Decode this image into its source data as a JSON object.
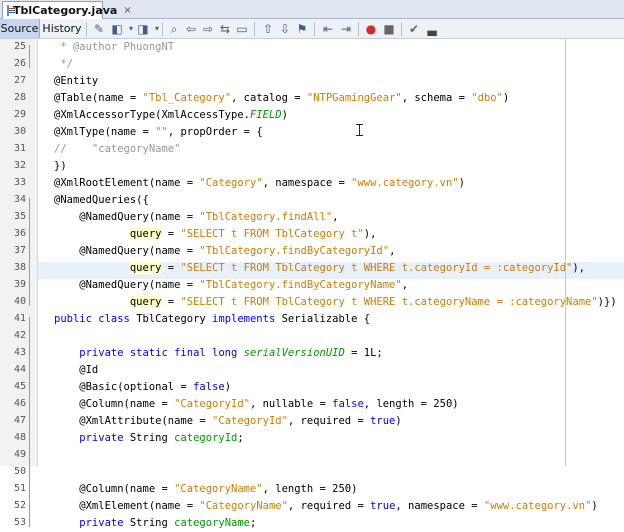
{
  "file_tab": {
    "title": "TblCategory.java",
    "close": "×"
  },
  "toolbar": {
    "source_label": "Source",
    "history_label": "History"
  },
  "lines": [
    {
      "n": "25",
      "segs": [
        {
          "t": " * ",
          "c": "cmt"
        },
        {
          "t": "@author PhuongNT",
          "c": "cmt"
        }
      ]
    },
    {
      "n": "26",
      "segs": [
        {
          "t": " */",
          "c": "cmt"
        }
      ]
    },
    {
      "n": "27",
      "segs": [
        {
          "t": "@Entity",
          "c": "ann"
        }
      ]
    },
    {
      "n": "28",
      "segs": [
        {
          "t": "@Table(name = ",
          "c": "ann"
        },
        {
          "t": "\"Tbl_Category\"",
          "c": "str"
        },
        {
          "t": ", catalog = ",
          "c": ""
        },
        {
          "t": "\"NTPGamingGear\"",
          "c": "str"
        },
        {
          "t": ", schema = ",
          "c": ""
        },
        {
          "t": "\"dbo\"",
          "c": "str"
        },
        {
          "t": ")",
          "c": ""
        }
      ]
    },
    {
      "n": "29",
      "segs": [
        {
          "t": "@XmlAccessorType(XmlAccessType.",
          "c": "ann"
        },
        {
          "t": "FIELD",
          "c": "ital"
        },
        {
          "t": ")",
          "c": ""
        }
      ]
    },
    {
      "n": "30",
      "segs": [
        {
          "t": "@XmlType(name = ",
          "c": "ann"
        },
        {
          "t": "\"\"",
          "c": "str"
        },
        {
          "t": ", propOrder = {",
          "c": ""
        }
      ]
    },
    {
      "n": "31",
      "segs": [
        {
          "t": "//    \"categoryName\"",
          "c": "cmt"
        }
      ]
    },
    {
      "n": "32",
      "segs": [
        {
          "t": "})",
          "c": ""
        }
      ]
    },
    {
      "n": "33",
      "segs": [
        {
          "t": "@XmlRootElement(name = ",
          "c": "ann"
        },
        {
          "t": "\"Category\"",
          "c": "str"
        },
        {
          "t": ", namespace = ",
          "c": ""
        },
        {
          "t": "\"www.category.vn\"",
          "c": "str"
        },
        {
          "t": ")",
          "c": ""
        }
      ]
    },
    {
      "n": "34",
      "segs": [
        {
          "t": "@NamedQueries({",
          "c": "ann"
        }
      ]
    },
    {
      "n": "35",
      "segs": [
        {
          "t": "    @NamedQuery(name = ",
          "c": "ann"
        },
        {
          "t": "\"TblCategory.findAll\"",
          "c": "str"
        },
        {
          "t": ",",
          "c": ""
        }
      ]
    },
    {
      "n": "36",
      "segs": [
        {
          "t": "            ",
          "c": ""
        },
        {
          "t": "query",
          "c": "q"
        },
        {
          "t": " = ",
          "c": ""
        },
        {
          "t": "\"SELECT t FROM TblCategory t\"",
          "c": "str"
        },
        {
          "t": "),",
          "c": ""
        }
      ]
    },
    {
      "n": "37",
      "segs": [
        {
          "t": "    @NamedQuery(name = ",
          "c": "ann"
        },
        {
          "t": "\"TblCategory.findByCategoryId\"",
          "c": "str"
        },
        {
          "t": ",",
          "c": ""
        }
      ]
    },
    {
      "n": "38",
      "segs": [
        {
          "t": "            ",
          "c": ""
        },
        {
          "t": "query",
          "c": "q"
        },
        {
          "t": " = ",
          "c": ""
        },
        {
          "t": "\"SELECT t FROM TblCategory t WHERE t.categoryId = :categoryId\"",
          "c": "str"
        },
        {
          "t": "),",
          "c": ""
        }
      ]
    },
    {
      "n": "39",
      "segs": [
        {
          "t": "    @NamedQuery(name = ",
          "c": "ann"
        },
        {
          "t": "\"TblCategory.findByCategoryName\"",
          "c": "str"
        },
        {
          "t": ",",
          "c": ""
        }
      ]
    },
    {
      "n": "40",
      "segs": [
        {
          "t": "            ",
          "c": ""
        },
        {
          "t": "query",
          "c": "q"
        },
        {
          "t": " = ",
          "c": ""
        },
        {
          "t": "\"SELECT t FROM TblCategory t WHERE t.categoryName = :categoryName\"",
          "c": "str"
        },
        {
          "t": ")})",
          "c": ""
        }
      ]
    },
    {
      "n": "41",
      "segs": [
        {
          "t": "public class ",
          "c": "kw"
        },
        {
          "t": "TblCategory ",
          "c": ""
        },
        {
          "t": "implements ",
          "c": "kw"
        },
        {
          "t": "Serializable {",
          "c": ""
        }
      ]
    },
    {
      "n": "42",
      "segs": []
    },
    {
      "n": "43",
      "segs": [
        {
          "t": "    private static final long ",
          "c": "kw"
        },
        {
          "t": "serialVersionUID",
          "c": "ital"
        },
        {
          "t": " = 1L;",
          "c": ""
        }
      ]
    },
    {
      "n": "44",
      "segs": [
        {
          "t": "    @Id",
          "c": "ann"
        }
      ]
    },
    {
      "n": "45",
      "segs": [
        {
          "t": "    @Basic(optional = ",
          "c": "ann"
        },
        {
          "t": "false",
          "c": "kw"
        },
        {
          "t": ")",
          "c": ""
        }
      ]
    },
    {
      "n": "46",
      "segs": [
        {
          "t": "    @Column(name = ",
          "c": "ann"
        },
        {
          "t": "\"CategoryId\"",
          "c": "str"
        },
        {
          "t": ", nullable = ",
          "c": ""
        },
        {
          "t": "false",
          "c": "kw"
        },
        {
          "t": ", length = 250)",
          "c": ""
        }
      ]
    },
    {
      "n": "47",
      "segs": [
        {
          "t": "    @XmlAttribute(name = ",
          "c": "ann"
        },
        {
          "t": "\"CategoryId\"",
          "c": "str"
        },
        {
          "t": ", required = ",
          "c": ""
        },
        {
          "t": "true",
          "c": "kw"
        },
        {
          "t": ")",
          "c": ""
        }
      ]
    },
    {
      "n": "48",
      "segs": [
        {
          "t": "    private ",
          "c": "kw"
        },
        {
          "t": "String ",
          "c": ""
        },
        {
          "t": "categoryId",
          "c": "fld"
        },
        {
          "t": ";",
          "c": ""
        }
      ]
    },
    {
      "n": "49",
      "segs": []
    },
    {
      "n": "50",
      "segs": []
    },
    {
      "n": "51",
      "segs": [
        {
          "t": "    @Column(name = ",
          "c": "ann"
        },
        {
          "t": "\"CategoryName\"",
          "c": "str"
        },
        {
          "t": ", length = 250)",
          "c": ""
        }
      ]
    },
    {
      "n": "52",
      "segs": [
        {
          "t": "    @XmlElement(name = ",
          "c": "ann"
        },
        {
          "t": "\"CategoryName\"",
          "c": "str"
        },
        {
          "t": ", required = ",
          "c": ""
        },
        {
          "t": "true",
          "c": "kw"
        },
        {
          "t": ", namespace = ",
          "c": ""
        },
        {
          "t": "\"www.category.vn\"",
          "c": "str"
        },
        {
          "t": ")",
          "c": ""
        }
      ]
    },
    {
      "n": "53",
      "segs": [
        {
          "t": "    private ",
          "c": "kw"
        },
        {
          "t": "String ",
          "c": ""
        },
        {
          "t": "categoryName",
          "c": "fld"
        },
        {
          "t": ";",
          "c": ""
        }
      ]
    }
  ]
}
